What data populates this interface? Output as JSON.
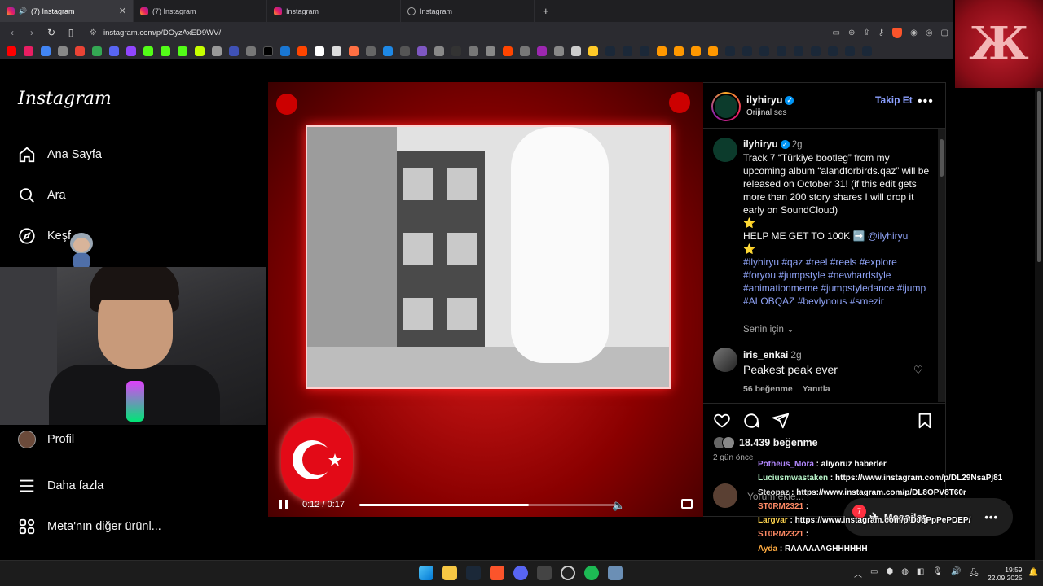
{
  "browser": {
    "tabs": [
      {
        "label": "(7) Instagram",
        "active": true
      },
      {
        "label": "(7) Instagram",
        "active": false
      },
      {
        "label": "Instagram",
        "active": false
      },
      {
        "label": "Instagram",
        "active": false
      }
    ],
    "url": "instagram.com/p/DOyzAxED9WV/"
  },
  "sidebar": {
    "logo": "Instagram",
    "items": [
      {
        "label": "Ana Sayfa",
        "icon": "home-icon"
      },
      {
        "label": "Ara",
        "icon": "search-icon"
      },
      {
        "label": "Keşfet",
        "icon": "compass-icon"
      },
      {
        "label": "Profil",
        "icon": "avatar"
      },
      {
        "label": "Daha fazla",
        "icon": "menu-icon"
      },
      {
        "label": "Meta'nın diğer ürünl...",
        "icon": "grid-icon"
      }
    ],
    "kesfet_visible": "Keşf"
  },
  "video": {
    "time": "0:12 / 0:17",
    "progress": 0.65
  },
  "post": {
    "username": "ilyhiryu",
    "audio": "Orijinal ses",
    "follow_label": "Takip Et",
    "caption_user": "ilyhiryu",
    "caption_age": "2g",
    "caption_text": "Track 7 “Türkiye bootleg” from my upcoming album “alandforbirds.qaz” will be released on October 31! (if this edit gets more than 200 story shares I will drop it early on SoundCloud)",
    "caption_line2": "HELP ME GET TO 100K ➡️",
    "caption_mention": "@ilyhiryu",
    "hashtags": "#ilyhiryu #qaz #reel #reels #explore #foryou #jumpstyle #newhardstyle #animationmeme #jumpstyledance #ijump #ALOBQAZ #bevlynous #smezir",
    "senin_icin": "Senin için",
    "comment": {
      "user": "iris_enkai",
      "age": "2g",
      "text": "Peakest peak ever",
      "likes": "56 beğenme",
      "reply": "Yanıtla"
    },
    "likes": "18.439 beğenme",
    "ago": "2 gün önce",
    "add_comment_placeholder": "Yorum ekle..."
  },
  "chat": [
    {
      "user": "Potheus_Mora",
      "color": "#b388ff",
      "text": "alıyoruz haberler"
    },
    {
      "user": "Luciusmwastaken",
      "color": "#b9f6ca",
      "text": "https://www.instagram.com/p/DL29NsaPj81"
    },
    {
      "user": "Steopaz",
      "color": "#e0e0e0",
      "text": "https://www.instagram.com/p/DL8OPV8T60r"
    },
    {
      "user": "ST0RM2321",
      "color": "#ff8a65",
      "text": ""
    },
    {
      "user": "Largvar",
      "color": "#ffd54f",
      "text": "https://www.instagram.com/p/DJqPpPePDEP/"
    },
    {
      "user": "ST0RM2321",
      "color": "#ff8a65",
      "text": ""
    },
    {
      "user": "Ayda",
      "color": "#ffab40",
      "text": "RAAAAAAGHHHHHH"
    }
  ],
  "messages": {
    "label": "Mesajlar",
    "badge": "7"
  },
  "taskbar": {
    "time": "19:59",
    "date": "22.09.2025"
  },
  "colors": {
    "accent": "#0095f6",
    "follow": "#8ba0ff",
    "hashtag": "#8ea2f5",
    "video_red": "#d81b1b"
  }
}
